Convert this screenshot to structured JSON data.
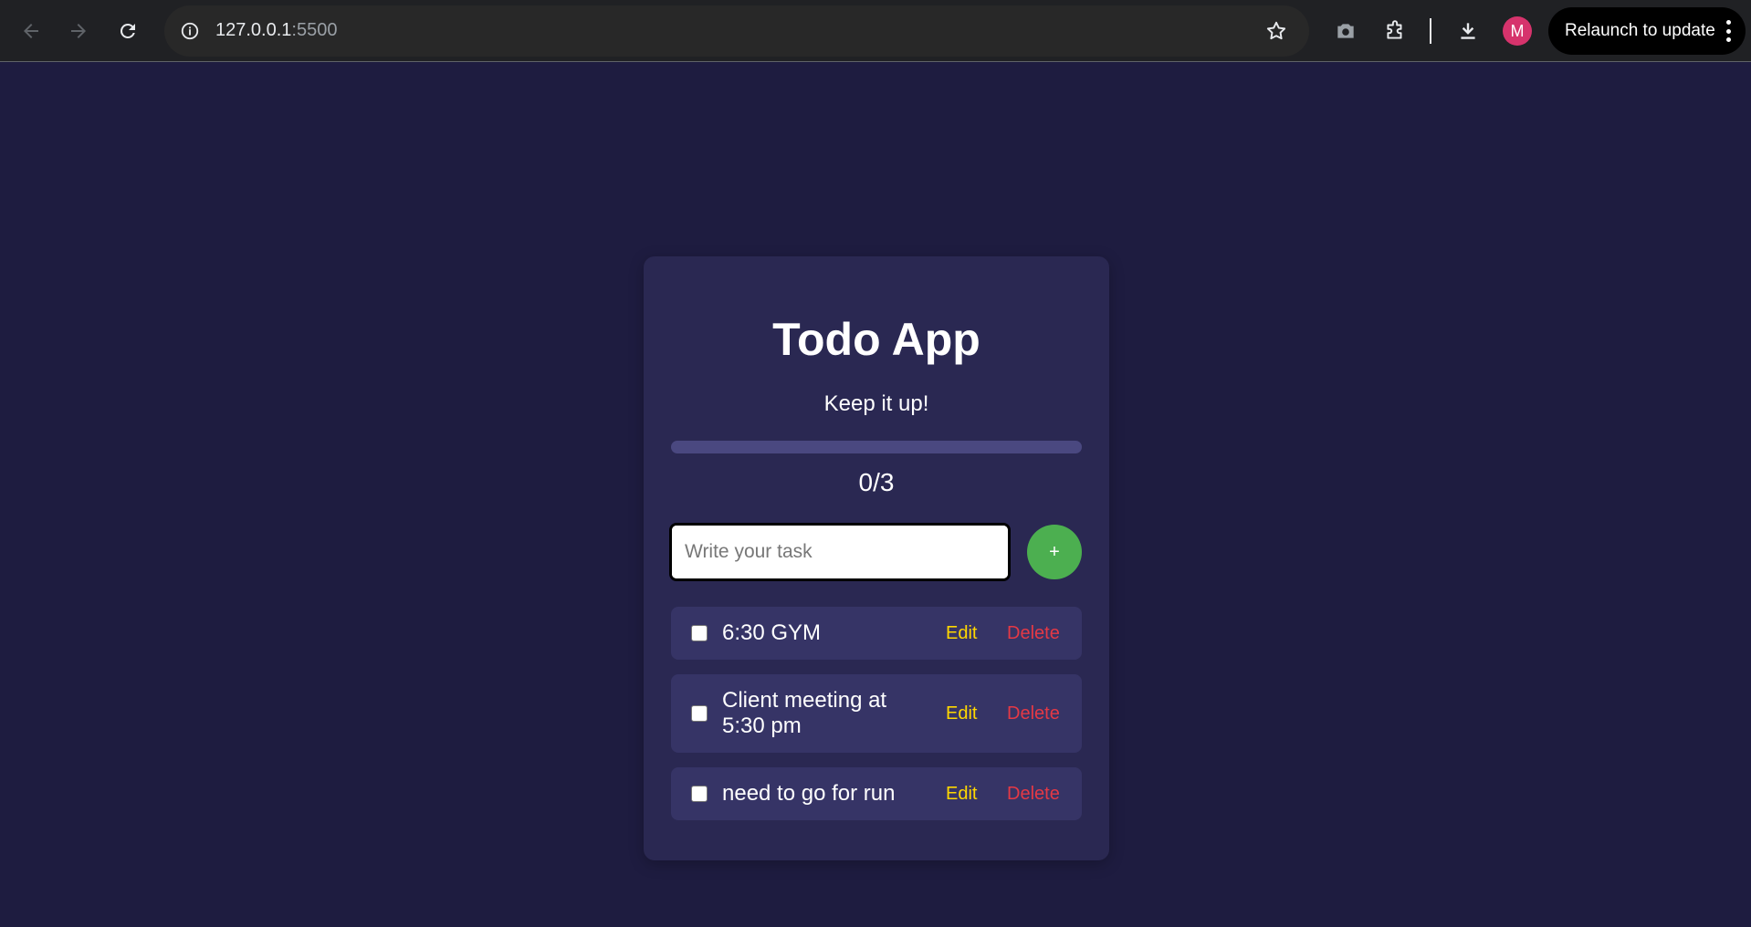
{
  "browser": {
    "url_host": "127.0.0.1",
    "url_port": ":5500",
    "avatar_letter": "M",
    "relaunch_label": "Relaunch to update"
  },
  "app": {
    "title": "Todo App",
    "subtitle": "Keep it up!",
    "progress_fraction": 0,
    "count_text": "0/3",
    "input_placeholder": "Write your task",
    "input_value": "",
    "add_button_label": "+",
    "tasks": [
      {
        "text": "6:30 GYM",
        "checked": false,
        "edit_label": "Edit",
        "delete_label": "Delete"
      },
      {
        "text": "Client meeting at 5:30 pm",
        "checked": false,
        "edit_label": "Edit",
        "delete_label": "Delete"
      },
      {
        "text": "need to go for run",
        "checked": false,
        "edit_label": "Edit",
        "delete_label": "Delete"
      }
    ]
  },
  "colors": {
    "page_bg": "#1e1c40",
    "card_bg": "#2a2852",
    "item_bg": "#363466",
    "accent_green": "#4caf50",
    "edit_yellow": "#ffd700",
    "delete_red": "#e53945"
  }
}
